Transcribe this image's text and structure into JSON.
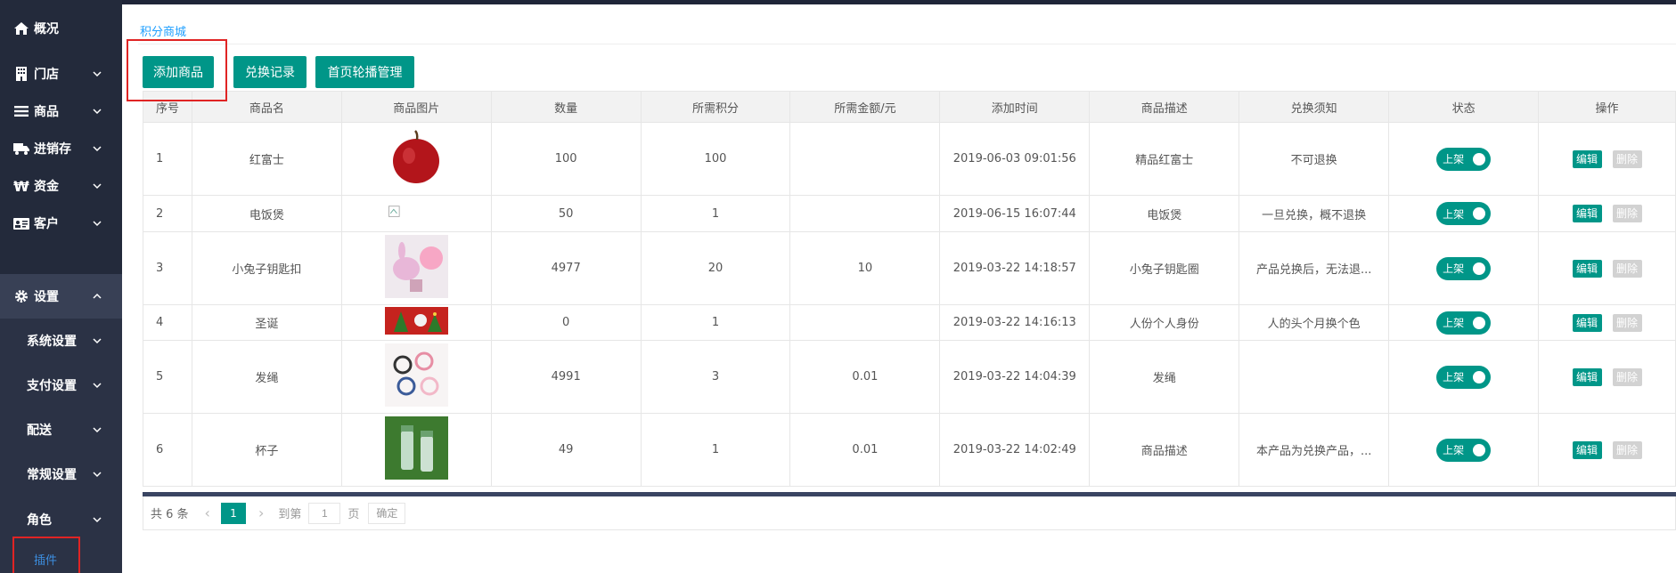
{
  "sidebar": {
    "items": [
      {
        "label": "概况",
        "icon": "home-icon"
      },
      {
        "label": "门店",
        "icon": "building-icon"
      },
      {
        "label": "商品",
        "icon": "list-icon"
      },
      {
        "label": "进销存",
        "icon": "truck-icon"
      },
      {
        "label": "资金",
        "icon": "won-icon"
      },
      {
        "label": "客户",
        "icon": "id-card-icon"
      },
      {
        "label": "设置",
        "icon": "gear-icon"
      }
    ],
    "sub_items": [
      "系统设置",
      "支付设置",
      "配送",
      "常规设置",
      "角色"
    ],
    "active_sub": "插件"
  },
  "breadcrumb": "积分商城",
  "toolbar": {
    "add_label": "添加商品",
    "records_label": "兑换记录",
    "carousel_label": "首页轮播管理"
  },
  "table": {
    "headers": [
      "序号",
      "商品名",
      "商品图片",
      "数量",
      "所需积分",
      "所需金额/元",
      "添加时间",
      "商品描述",
      "兑换须知",
      "状态",
      "操作"
    ],
    "rows": [
      {
        "idx": "1",
        "name": "红富士",
        "image": "apple",
        "qty": "100",
        "points": "100",
        "amount": "",
        "time": "2019-06-03 09:01:56",
        "desc": "精品红富士",
        "notice": "不可退换",
        "status": "上架",
        "edit": "编辑",
        "del": "删除"
      },
      {
        "idx": "2",
        "name": "电饭煲",
        "image": "broken",
        "qty": "50",
        "points": "1",
        "amount": "",
        "time": "2019-06-15 16:07:44",
        "desc": "电饭煲",
        "notice": "一旦兑换，概不退换",
        "status": "上架",
        "edit": "编辑",
        "del": "删除"
      },
      {
        "idx": "3",
        "name": "小兔子钥匙扣",
        "image": "rabbit",
        "qty": "4977",
        "points": "20",
        "amount": "10",
        "time": "2019-03-22 14:18:57",
        "desc": "小兔子钥匙圈",
        "notice": "产品兑换后，无法退...",
        "status": "上架",
        "edit": "编辑",
        "del": "删除"
      },
      {
        "idx": "4",
        "name": "圣诞",
        "image": "xmas",
        "qty": "0",
        "points": "1",
        "amount": "",
        "time": "2019-03-22 14:16:13",
        "desc": "人份个人身份",
        "notice": "人的头个月换个色",
        "status": "上架",
        "edit": "编辑",
        "del": "删除"
      },
      {
        "idx": "5",
        "name": "发绳",
        "image": "hairtie",
        "qty": "4991",
        "points": "3",
        "amount": "0.01",
        "time": "2019-03-22 14:04:39",
        "desc": "发绳",
        "notice": "",
        "status": "上架",
        "edit": "编辑",
        "del": "删除"
      },
      {
        "idx": "6",
        "name": "杯子",
        "image": "cup",
        "qty": "49",
        "points": "1",
        "amount": "0.01",
        "time": "2019-03-22 14:02:49",
        "desc": "商品描述",
        "notice": "本产品为兑换产品，...",
        "status": "上架",
        "edit": "编辑",
        "del": "删除"
      }
    ]
  },
  "pager": {
    "total": "共 6 条",
    "current": "1",
    "goto": "到第",
    "input": "1",
    "unit": "页",
    "confirm": "确定"
  }
}
